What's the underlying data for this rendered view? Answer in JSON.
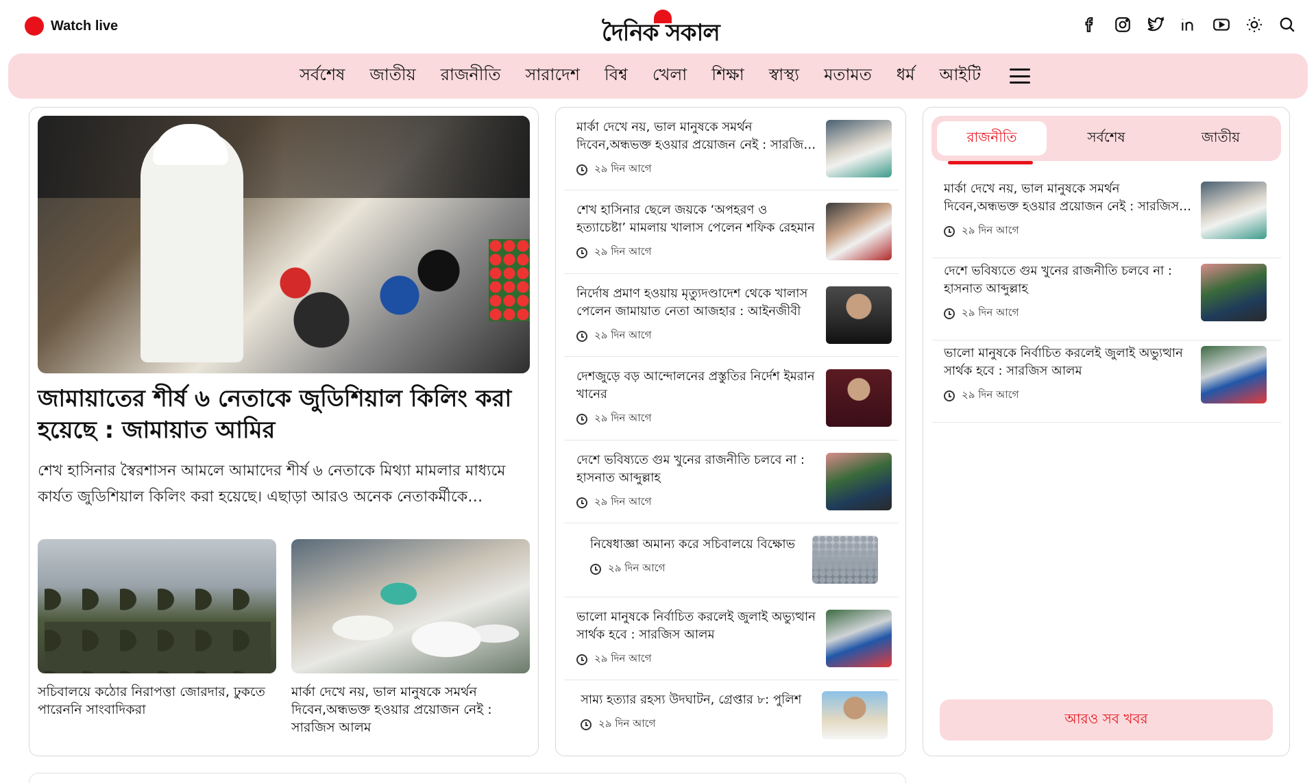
{
  "header": {
    "watch_live": "Watch live",
    "logo": "দৈনিক সকাল",
    "icons": [
      "facebook-icon",
      "instagram-icon",
      "twitter-icon",
      "linkedin-icon",
      "youtube-icon",
      "theme-toggle-icon",
      "search-icon"
    ],
    "accent": "#e8111a"
  },
  "nav": {
    "items": [
      "সর্বশেষ",
      "জাতীয়",
      "রাজনীতি",
      "সারাদেশ",
      "বিশ্ব",
      "খেলা",
      "শিক্ষা",
      "স্বাস্থ্য",
      "মতামত",
      "ধর্ম",
      "আইটি"
    ],
    "background": "#fadadd"
  },
  "lead": {
    "title": "জামায়াতের শীর্ষ ৬ নেতাকে জুডিশিয়াল কিলিং করা হয়েছে : জামায়াত আমির",
    "summary": "শেখ হাসিনার স্বৈরশাসন আমলে আমাদের শীর্ষ ৬ নেতাকে মিথ্যা মামলার মাধ্যমে কার্যত জুডিশিয়াল কিলিং করা হয়েছে। এছাড়া আরও অনেক নেতাকর্মীকে নির্মমভাবে হত্যা করা হয়েছে।",
    "sub": [
      {
        "title": "সচিবালয়ে কঠোর নিরাপত্তা জোরদার, ঢুকতে পারেননি সাংবাদিকরা"
      },
      {
        "title": "মার্কা দেখে নয়, ভাল মানুষকে সমর্থন দিবেন,অন্ধভক্ত হওয়ার প্রয়োজন নেই : সারজিস আলম"
      }
    ]
  },
  "mid_list": [
    {
      "title": "মার্কা দেখে নয়, ভাল মানুষকে সমর্থন দিবেন,অন্ধভক্ত হওয়ার প্রয়োজন নেই : সারজিস আলম",
      "time": "২৯ দিন আগে"
    },
    {
      "title": "শেখ হাসিনার ছেলে জয়কে ‘অপহরণ ও হত্যাচেষ্টা’ মামলায় খালাস পেলেন শফিক রেহমান",
      "time": "২৯ দিন আগে"
    },
    {
      "title": "নির্দোষ প্রমাণ হওয়ায় মৃত্যুদণ্ডাদেশ থেকে খালাস পেলেন জামায়াত নেতা আজহার : আইনজীবী",
      "time": "২৯ দিন আগে"
    },
    {
      "title": "দেশজুড়ে বড় আন্দোলনের প্রস্তুতির নির্দেশ ইমরান খানের",
      "time": "২৯ দিন আগে"
    },
    {
      "title": "দেশে ভবিষ্যতে গুম খুনের রাজনীতি চলবে না : হাসনাত আব্দুল্লাহ",
      "time": "২৯ দিন আগে"
    },
    {
      "title": "নিষেধাজ্ঞা অমান্য করে সচিবালয়ে বিক্ষোভ",
      "time": "২৯ দিন আগে"
    },
    {
      "title": "ভালো মানুষকে নির্বাচিত করলেই জুলাই অভ্যুত্থান সার্থক হবে : সারজিস আলম",
      "time": "২৯ দিন আগে"
    },
    {
      "title": "সাম্য হত্যার রহস্য উদঘাটন, গ্রেপ্তার ৮: পুলিশ",
      "time": "২৯ দিন আগে"
    }
  ],
  "sidebar": {
    "tabs": [
      "রাজনীতি",
      "সর্বশেষ",
      "জাতীয়"
    ],
    "active_tab": "রাজনীতি",
    "items": [
      {
        "title": "মার্কা দেখে নয়, ভাল মানুষকে সমর্থন দিবেন,অন্ধভক্ত হওয়ার প্রয়োজন নেই : সারজিস আলম",
        "time": "২৯ দিন আগে"
      },
      {
        "title": "দেশে ভবিষ্যতে গুম খুনের রাজনীতি চলবে না : হাসনাত আব্দুল্লাহ",
        "time": "২৯ দিন আগে"
      },
      {
        "title": "ভালো মানুষকে নির্বাচিত করলেই জুলাই অভ্যুত্থান সার্থক হবে : সারজিস আলম",
        "time": "২৯ দিন আগে"
      }
    ],
    "more_button": "আরও সব খবর"
  }
}
